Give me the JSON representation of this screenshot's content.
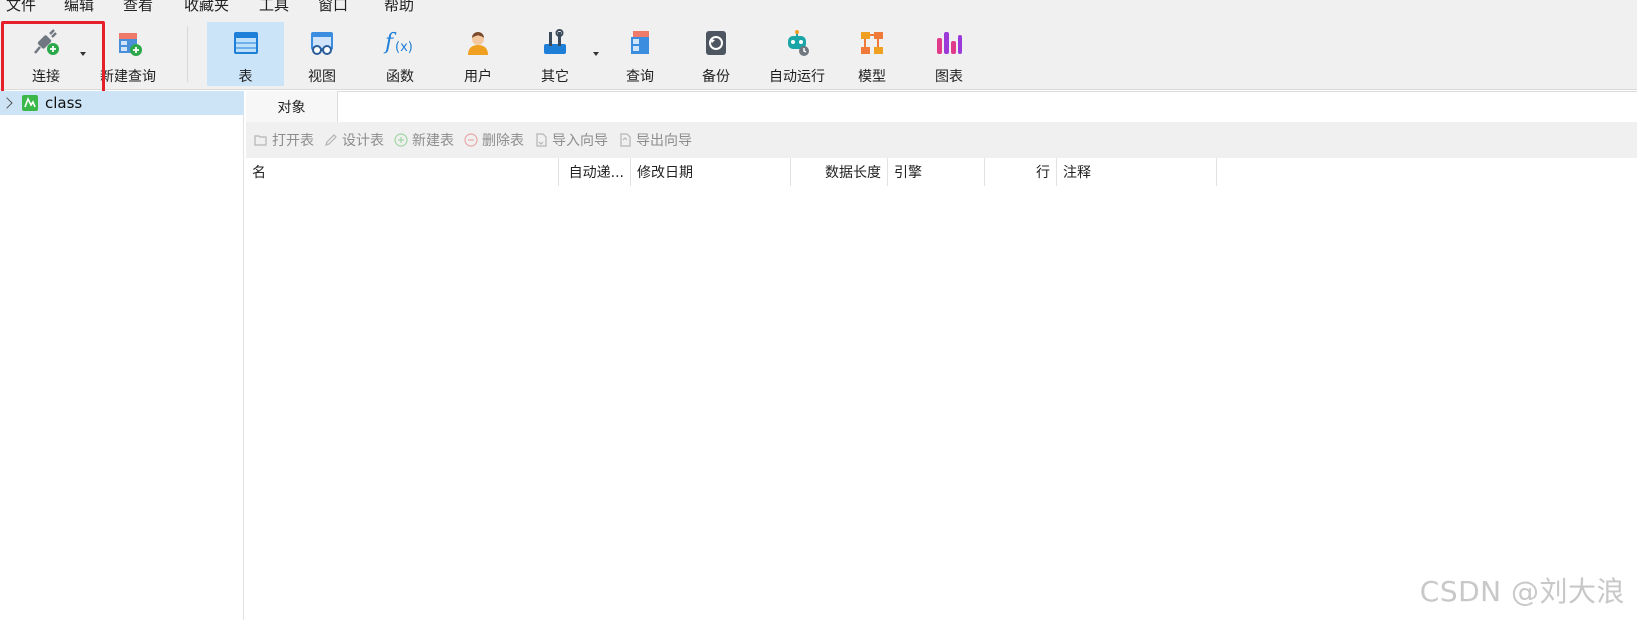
{
  "menu": [
    "文件",
    "编辑",
    "查看",
    "收藏夹",
    "工具",
    "窗口",
    "帮助"
  ],
  "toolbar": {
    "connect": "连接",
    "new_query": "新建查询",
    "table": "表",
    "view": "视图",
    "function": "函数",
    "user": "用户",
    "other": "其它",
    "query": "查询",
    "backup": "备份",
    "automation": "自动运行",
    "model": "模型",
    "chart": "图表"
  },
  "nav": {
    "connection_name": "class"
  },
  "objects": {
    "tab": "对象",
    "actions": {
      "open_table": "打开表",
      "design_table": "设计表",
      "new_table": "新建表",
      "delete_table": "删除表",
      "import_wizard": "导入向导",
      "export_wizard": "导出向导"
    },
    "columns": {
      "name": "名",
      "auto_increment": "自动递...",
      "modified_date": "修改日期",
      "data_length": "数据长度",
      "engine": "引擎",
      "rows": "行",
      "comment": "注释"
    }
  },
  "watermark": "CSDN @刘大浪",
  "colors": {
    "active_tab": "#cce4f7",
    "highlight": "#e5202b",
    "toolbar_bg": "#f0f0f0"
  }
}
